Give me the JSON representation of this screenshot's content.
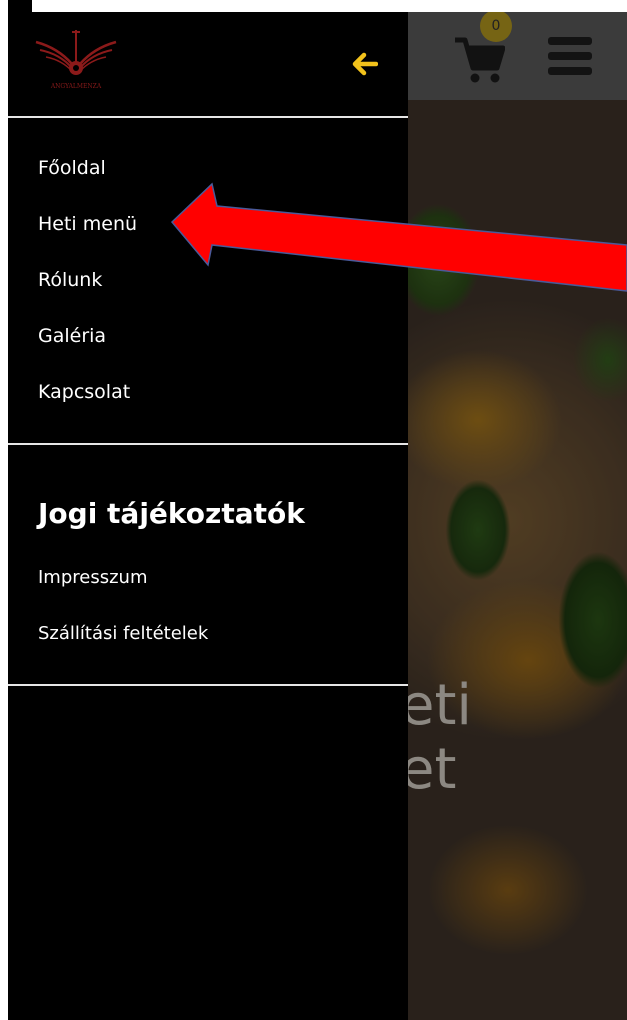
{
  "colors": {
    "drawer_bg": "#000000",
    "accent_yellow": "#f2c21b",
    "arrow_red": "#ff0000",
    "logo_red": "#8b1a1a"
  },
  "header": {
    "cart_count": "0",
    "cart_icon": "cart-icon",
    "menu_icon": "hamburger-icon"
  },
  "drawer": {
    "logo_text": "ANGYALMENZA",
    "back_icon": "arrow-left-icon",
    "nav": [
      {
        "label": "Főoldal"
      },
      {
        "label": "Heti menü"
      },
      {
        "label": "Rólunk"
      },
      {
        "label": "Galéria"
      },
      {
        "label": "Kapcsolat"
      }
    ],
    "legal": {
      "title": "Jogi tájékoztatók",
      "items": [
        {
          "label": "Impresszum"
        },
        {
          "label": "Szállítási feltételek"
        }
      ]
    }
  },
  "hero": {
    "line1": "eti",
    "line2": "et"
  }
}
